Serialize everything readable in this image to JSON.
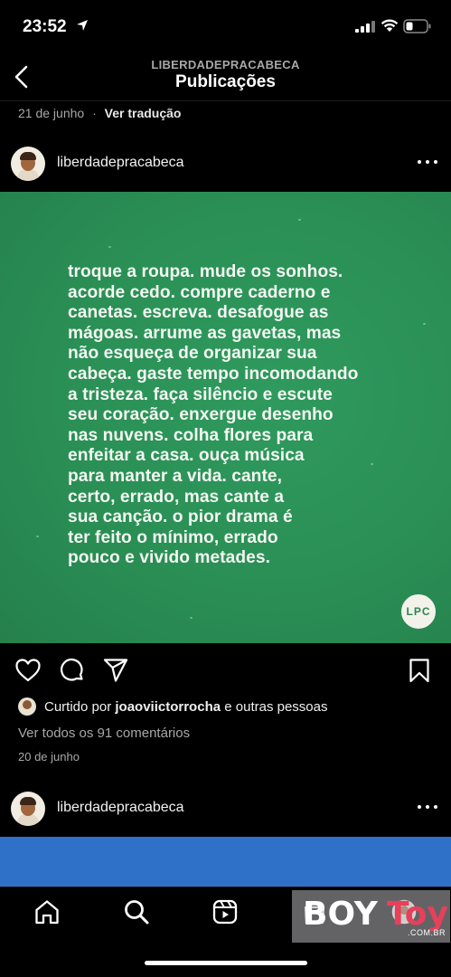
{
  "status_bar": {
    "time": "23:52"
  },
  "header": {
    "account": "LIBERDADEPRACABECA",
    "title": "Publicações"
  },
  "previous_post": {
    "date": "21 de junho",
    "separator": "·",
    "translate": "Ver tradução"
  },
  "post": {
    "username": "liberdadepracabeca",
    "quote_lines": [
      "troque a roupa. mude os sonhos.",
      "acorde cedo. compre caderno e",
      "canetas. escreva. desafogue as",
      "mágoas. arrume as gavetas, mas",
      "não esqueça de organizar sua",
      "cabeça. gaste tempo incomodando",
      "a tristeza. faça silêncio e escute",
      "seu coração. enxergue desenho",
      "nas nuvens. colha flores para",
      "enfeitar a casa. ouça música",
      "para manter a vida. cante,",
      "certo, errado, mas cante a",
      "sua canção. o pior drama é",
      "ter feito o mínimo, errado",
      "pouco e vivido metades."
    ],
    "logo_text": "LPC",
    "likes_prefix": "Curtido por",
    "liked_by": "joaoviictorrocha",
    "likes_suffix": "e outras pessoas",
    "comments": "Ver todos os 91 comentários",
    "date": "20 de junho",
    "image_color": "#2a8f55"
  },
  "next_post": {
    "username": "liberdadepracabeca",
    "image_color": "#2f71c9"
  },
  "tab_bar": {
    "icons": [
      "home-icon",
      "search-icon",
      "reels-icon",
      "shop-icon",
      "profile-icon"
    ]
  },
  "watermark": {
    "brand": "BOY",
    "brand2": "Toy",
    "domain": ".COM.BR"
  }
}
